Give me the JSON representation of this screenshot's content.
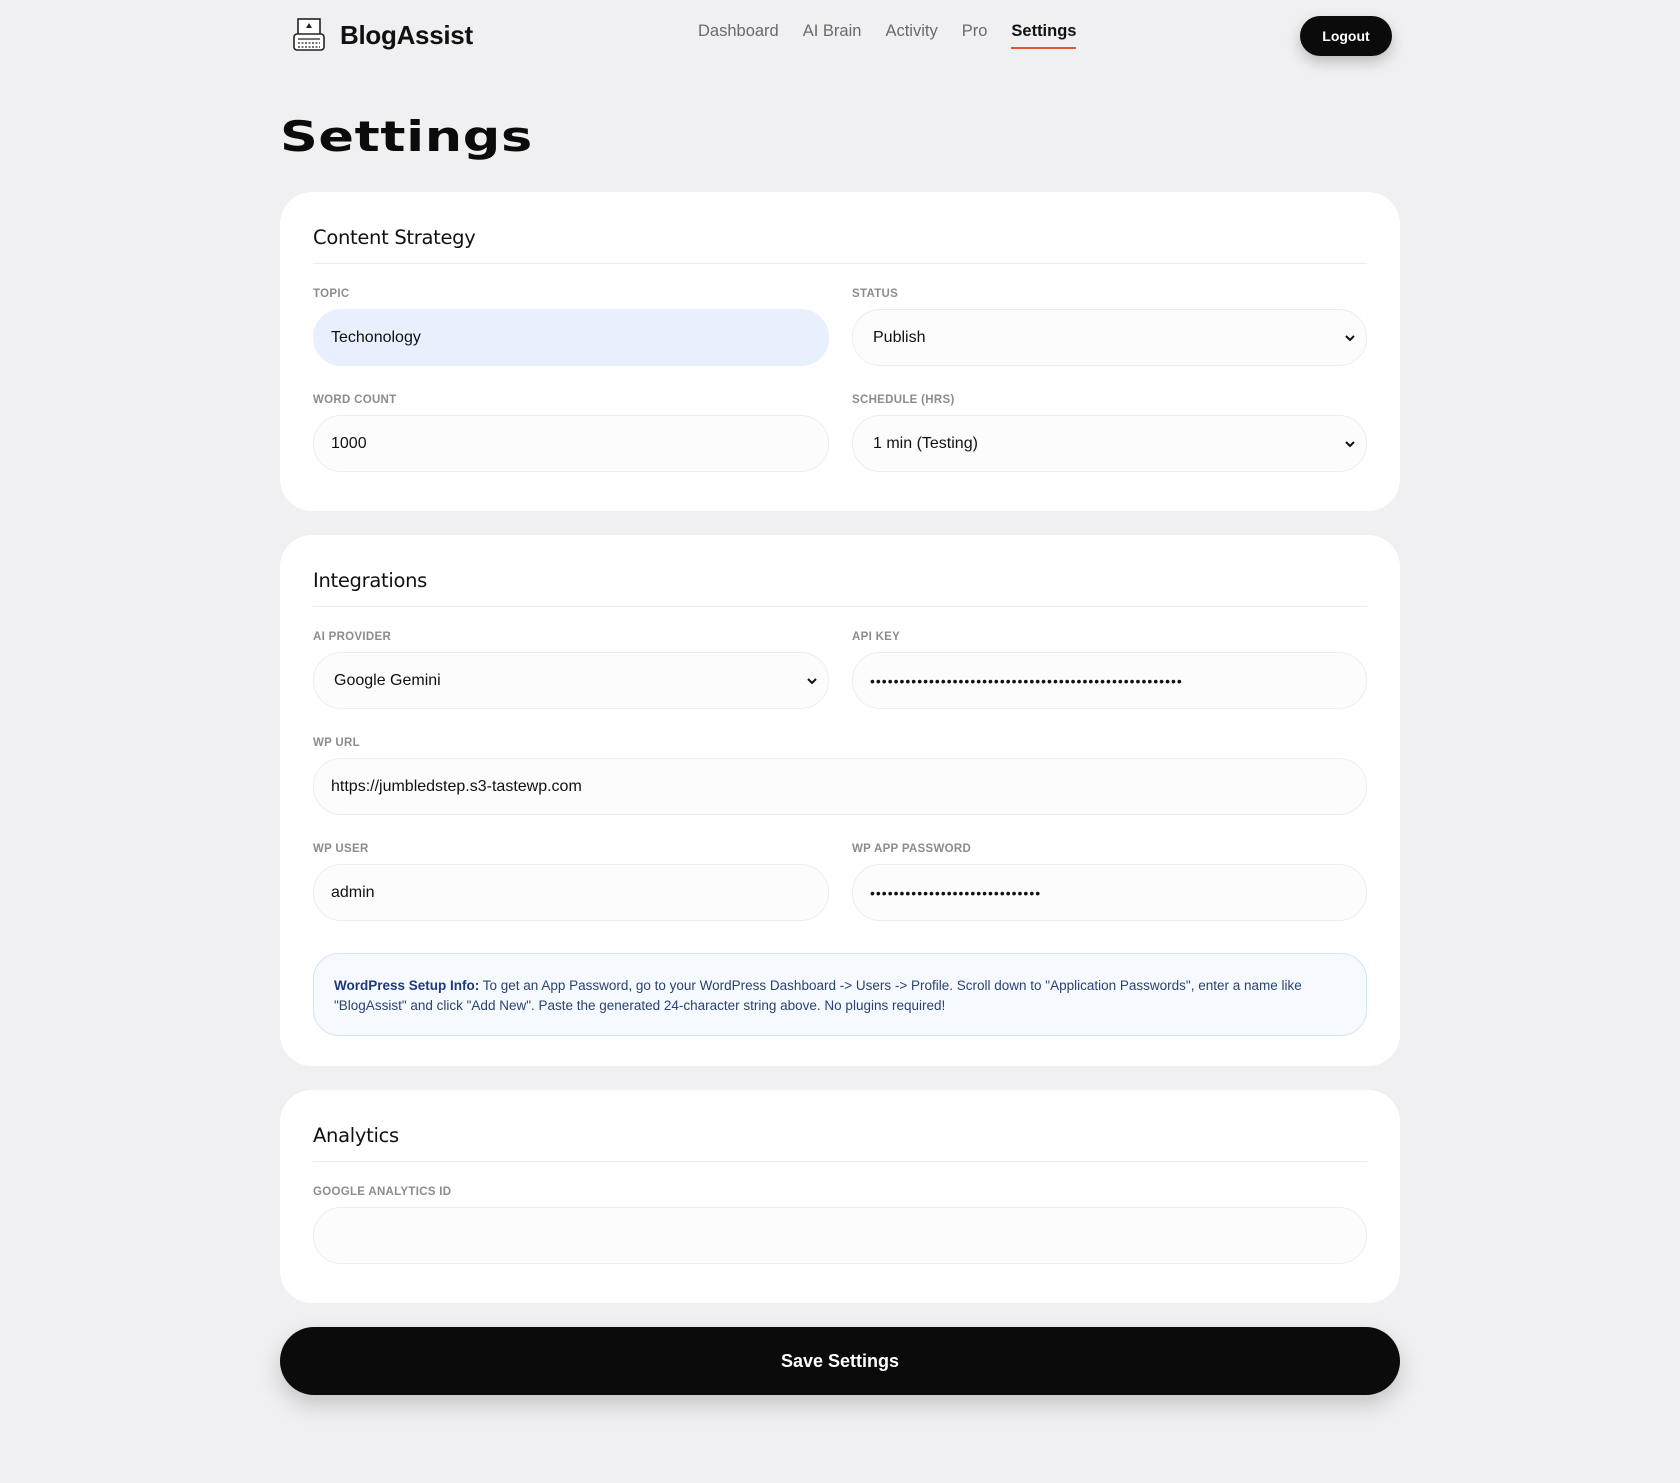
{
  "header": {
    "brand": "BlogAssist",
    "nav": [
      "Dashboard",
      "AI Brain",
      "Activity",
      "Pro",
      "Settings"
    ],
    "active_nav": "Settings",
    "logout_label": "Logout"
  },
  "page_title": "Settings",
  "content_strategy": {
    "title": "Content Strategy",
    "topic_label": "TOPIC",
    "topic_value": "Techonology",
    "status_label": "STATUS",
    "status_value": "Publish",
    "word_count_label": "WORD COUNT",
    "word_count_value": "1000",
    "schedule_label": "SCHEDULE (HRS)",
    "schedule_value": "1 min (Testing)"
  },
  "integrations": {
    "title": "Integrations",
    "provider_label": "AI PROVIDER",
    "provider_value": "Google Gemini",
    "api_key_label": "API KEY",
    "api_key_value": "•••••••••••••••••••••••••••••••••••••••••••••••••••••",
    "wp_url_label": "WP URL",
    "wp_url_value": "https://jumbledstep.s3-tastewp.com",
    "wp_user_label": "WP USER",
    "wp_user_value": "admin",
    "wp_password_label": "WP APP PASSWORD",
    "wp_password_value": "•••••••••••••••••••••••••••••",
    "info_title": "WordPress Setup Info:",
    "info_text": " To get an App Password, go to your WordPress Dashboard -> Users -> Profile. Scroll down to \"Application Passwords\", enter a name like \"BlogAssist\" and click \"Add New\". Paste the generated 24-character string above. No plugins required!"
  },
  "analytics": {
    "title": "Analytics",
    "ga_label": "GOOGLE ANALYTICS ID",
    "ga_value": ""
  },
  "save_label": "Save Settings",
  "colors": {
    "accent": "#e4572e",
    "button": "#0b0b0b",
    "background": "#f0f0f2",
    "info_bg": "#f6f9fe",
    "highlight_input": "#e8f0fe"
  }
}
